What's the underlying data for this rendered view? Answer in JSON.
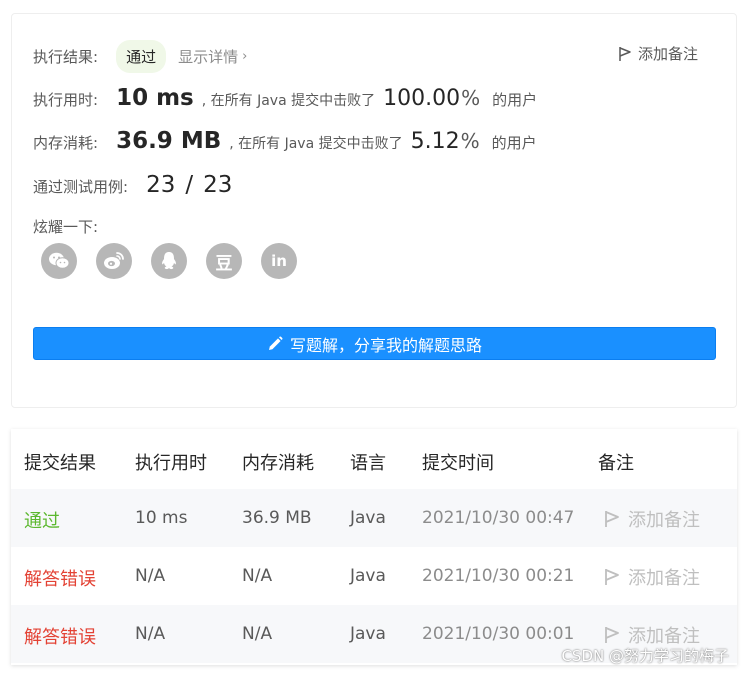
{
  "result": {
    "label": "执行结果:",
    "status": "通过",
    "detail_link": "显示详情",
    "add_note": "添加备注"
  },
  "runtime": {
    "label": "执行用时:",
    "value": "10 ms",
    "middle_text": ", 在所有 Java 提交中击败了",
    "percent": "100.00",
    "percent_sign": "%",
    "suffix": "的用户"
  },
  "memory": {
    "label": "内存消耗:",
    "value": "36.9 MB",
    "middle_text": ", 在所有 Java 提交中击败了",
    "percent": "5.12",
    "percent_sign": "%",
    "suffix": "的用户"
  },
  "tests": {
    "label": "通过测试用例:",
    "passed": "23",
    "slash": "/",
    "total": "23"
  },
  "share": {
    "label": "炫耀一下:",
    "icons": [
      "wechat-icon",
      "weibo-icon",
      "qq-icon",
      "douban-icon",
      "linkedin-icon"
    ],
    "douban_glyph": "豆",
    "linkedin_glyph": "in"
  },
  "write_button": "写题解，分享我的解题思路",
  "table": {
    "headers": [
      "提交结果",
      "执行用时",
      "内存消耗",
      "语言",
      "提交时间",
      "备注"
    ],
    "rows": [
      {
        "status": "通过",
        "runtime": "10 ms",
        "memory": "36.9 MB",
        "language": "Java",
        "time": "2021/10/30 00:47",
        "note": "添加备注"
      },
      {
        "status": "解答错误",
        "runtime": "N/A",
        "memory": "N/A",
        "language": "Java",
        "time": "2021/10/30 00:21",
        "note": "添加备注"
      },
      {
        "status": "解答错误",
        "runtime": "N/A",
        "memory": "N/A",
        "language": "Java",
        "time": "2021/10/30 00:01",
        "note": "添加备注"
      }
    ]
  },
  "watermark": "CSDN @努力学习的梅子",
  "colors": {
    "accent": "#1a90ff",
    "pass": "#5cb82f",
    "fail": "#e34234"
  }
}
